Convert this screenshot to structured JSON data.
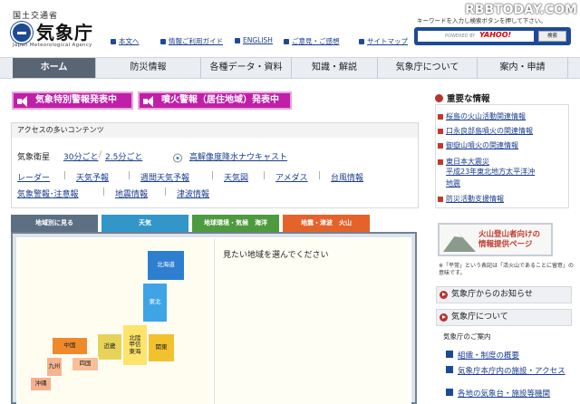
{
  "header": {
    "ministry": "国土交通省",
    "logo_jp": "気象庁",
    "logo_en": "Japan Meteorological Agency",
    "watermark": "RBBTODAY.COM",
    "keyword_label": "キーワードを入力し検索ボタンを押して下さい。",
    "search_placeholder": "POWERED BY",
    "yahoo_label": "YAHOO!",
    "search_button": "検索",
    "utility_links": [
      "本文へ",
      "情報ご利用ガイド",
      "ENGLISH",
      "ご意見・ご感想",
      "サイトマップ"
    ]
  },
  "nav": [
    "ホーム",
    "防災情報",
    "各種データ・資料",
    "知識・解説",
    "気象庁について",
    "案内・申請"
  ],
  "warnings": [
    "気象特別警報発表中",
    "噴火警報（居住地域）発表中"
  ],
  "access": {
    "heading": "アクセスの多いコンテンツ",
    "satellite_label": "気象衛星",
    "satellite_links": [
      "30分ごと",
      "2.5分ごと"
    ],
    "nowcast": "高解像度降水ナウキャスト",
    "row1": [
      "レーダー",
      "天気予報",
      "週間天気予報",
      "天気図",
      "アメダス",
      "台風情報"
    ],
    "row2": [
      "気象警報･注意報",
      "地震情報",
      "津波情報"
    ]
  },
  "tabs": [
    {
      "label": "地域別に見る",
      "color": "#5d6f82"
    },
    {
      "label": "天気",
      "color": "#3296c8"
    },
    {
      "label": "地球環境・気候　海洋",
      "color": "#4e9a3e"
    },
    {
      "label": "地震・津波　火山",
      "color": "#e5622a"
    }
  ],
  "map": {
    "message": "見たい地域を選んでください",
    "regions": [
      "北海道",
      "東北",
      "関東",
      "北陸\n甲信\n東海",
      "近畿",
      "中国",
      "四国",
      "九州",
      "沖縄"
    ]
  },
  "sidebar": {
    "important_title": "重要な情報",
    "important_items": [
      "桜島の火山活動関連情報",
      "口永良部島噴火の関連情報",
      "御嶽山噴火の関連情報",
      "東日本大震災",
      "平成23年東北地方太平洋沖",
      "地震",
      "防災活動支援情報"
    ],
    "volcano_banner": "火山登山者向けの\n情報提供ページ",
    "note": "※「平常」という表記は「活火山であることに留意」の意味です。",
    "notice_header": "気象庁からのお知らせ",
    "about_header": "気象庁について",
    "about_sub": "気象庁のご案内",
    "about_items": [
      "組織・制度の概要",
      "気象庁本庁内の施設・アクセス",
      "各地の気象台・施設等機関"
    ]
  },
  "colors": {
    "accent": "#1d4a96",
    "warning": "#c01fa8",
    "alert_red": "#c0392b",
    "nav_active": "#5a6574"
  }
}
